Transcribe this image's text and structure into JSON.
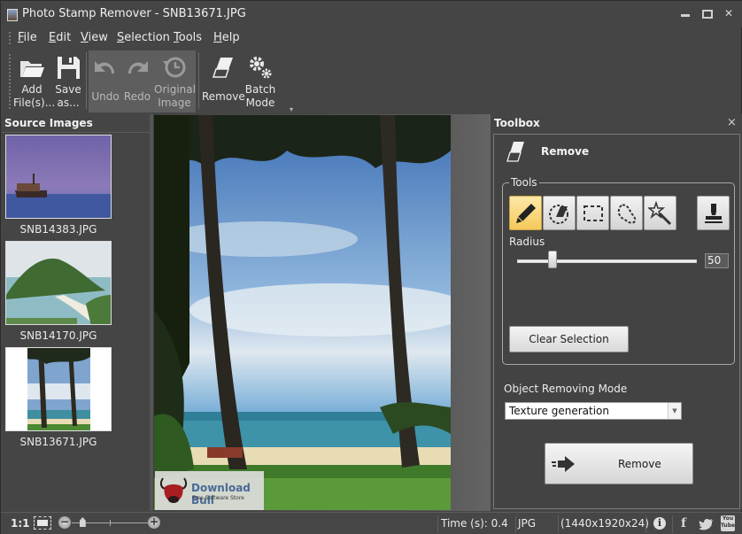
{
  "window": {
    "title": "Photo Stamp Remover - SNB13671.JPG",
    "controls": {
      "minimize": "minimize",
      "maximize": "maximize",
      "close": "✕"
    }
  },
  "menu": [
    {
      "label": "File",
      "accel": "F",
      "rest": "ile"
    },
    {
      "label": "Edit",
      "accel": "E",
      "rest": "dit"
    },
    {
      "label": "View",
      "accel": "V",
      "rest": "iew"
    },
    {
      "label": "Selection",
      "accel": "S",
      "rest": "election"
    },
    {
      "label": "Tools",
      "accel": "T",
      "rest": "ools"
    },
    {
      "label": "Help",
      "accel": "H",
      "rest": "elp"
    }
  ],
  "toolbar": {
    "add_files": {
      "line1": "Add",
      "line2": "File(s)...",
      "icon": "folder-open-icon"
    },
    "save_as": {
      "line1": "Save",
      "line2": "as...",
      "icon": "floppy-disk-icon"
    },
    "undo": {
      "label": "Undo",
      "icon": "undo-icon",
      "enabled": false
    },
    "redo": {
      "label": "Redo",
      "icon": "redo-icon",
      "enabled": false
    },
    "original_image": {
      "line1": "Original",
      "line2": "Image",
      "icon": "history-clock-icon",
      "enabled": false
    },
    "remove": {
      "label": "Remove",
      "icon": "eraser-icon"
    },
    "batch_mode": {
      "line1": "Batch",
      "line2": "Mode",
      "icon": "gears-icon"
    },
    "overflow": "▾"
  },
  "source_images": {
    "title": "Source Images",
    "items": [
      {
        "filename": "SNB14383.JPG",
        "scene": "boat at dusk"
      },
      {
        "filename": "SNB14170.JPG",
        "scene": "island and beach"
      },
      {
        "filename": "SNB13671.JPG",
        "scene": "palm trees on beach",
        "selected": true
      }
    ]
  },
  "canvas": {
    "watermark_title": "Download Bull",
    "watermark_subtitle": "Free Software Store"
  },
  "toolbox": {
    "title": "Toolbox",
    "close": "×",
    "mode_title": "Remove",
    "tools_group_label": "Tools",
    "tools": [
      {
        "name": "brush",
        "icon": "pencil-icon",
        "active": true
      },
      {
        "name": "eraser-selection",
        "icon": "selection-eraser-icon",
        "active": false
      },
      {
        "name": "rectangle-selection",
        "icon": "rectangle-select-icon",
        "active": false
      },
      {
        "name": "lasso-selection",
        "icon": "lasso-icon",
        "active": false
      },
      {
        "name": "magic-wand",
        "icon": "magic-wand-icon",
        "active": false
      },
      {
        "name": "stamp",
        "icon": "stamp-icon",
        "active": false
      }
    ],
    "radius_label": "Radius",
    "radius_value": "50",
    "radius_fraction": 0.17,
    "clear_selection_label": "Clear Selection",
    "object_removing_mode_label": "Object Removing Mode",
    "object_removing_mode_value": "Texture generation",
    "remove_button_label": "Remove"
  },
  "statusbar": {
    "zoom_actual": "1:1",
    "zoom_minus": "−",
    "zoom_plus": "+",
    "zoom_fraction": 0.1,
    "time": "Time (s): 0.4",
    "format": "JPG",
    "dimensions": "(1440x1920x24)",
    "social": {
      "facebook": "f",
      "twitter": "twitter",
      "youtube": "You Tube",
      "info": "i"
    }
  }
}
